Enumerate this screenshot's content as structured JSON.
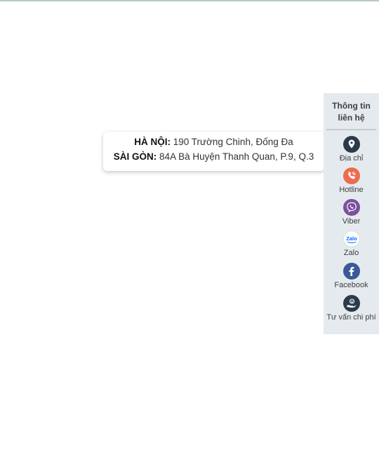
{
  "panel": {
    "title_line1": "Thông tin",
    "title_line2": "liên hệ",
    "items": [
      {
        "label": "Địa chỉ",
        "icon": "location-pin-icon",
        "color": "#2b3a4a"
      },
      {
        "label": "Hotline",
        "icon": "phone-icon",
        "color": "#ee6b4d"
      },
      {
        "label": "Viber",
        "icon": "viber-icon",
        "color": "#7b519d"
      },
      {
        "label": "Zalo",
        "icon": "zalo-icon",
        "color": "#0068ff"
      },
      {
        "label": "Facebook",
        "icon": "facebook-icon",
        "color": "#3b5998"
      },
      {
        "label": "Tư vấn chi phí",
        "icon": "money-hand-icon",
        "color": "#2b3a4a"
      }
    ]
  },
  "address_popup": {
    "hanoi_label": "HÀ NỘI:",
    "hanoi_address": "190 Trường Chinh, Đống Đa",
    "saigon_label": "SÀI GÒN:",
    "saigon_address": "84A Bà Huyện Thanh Quan, P.9, Q.3"
  }
}
